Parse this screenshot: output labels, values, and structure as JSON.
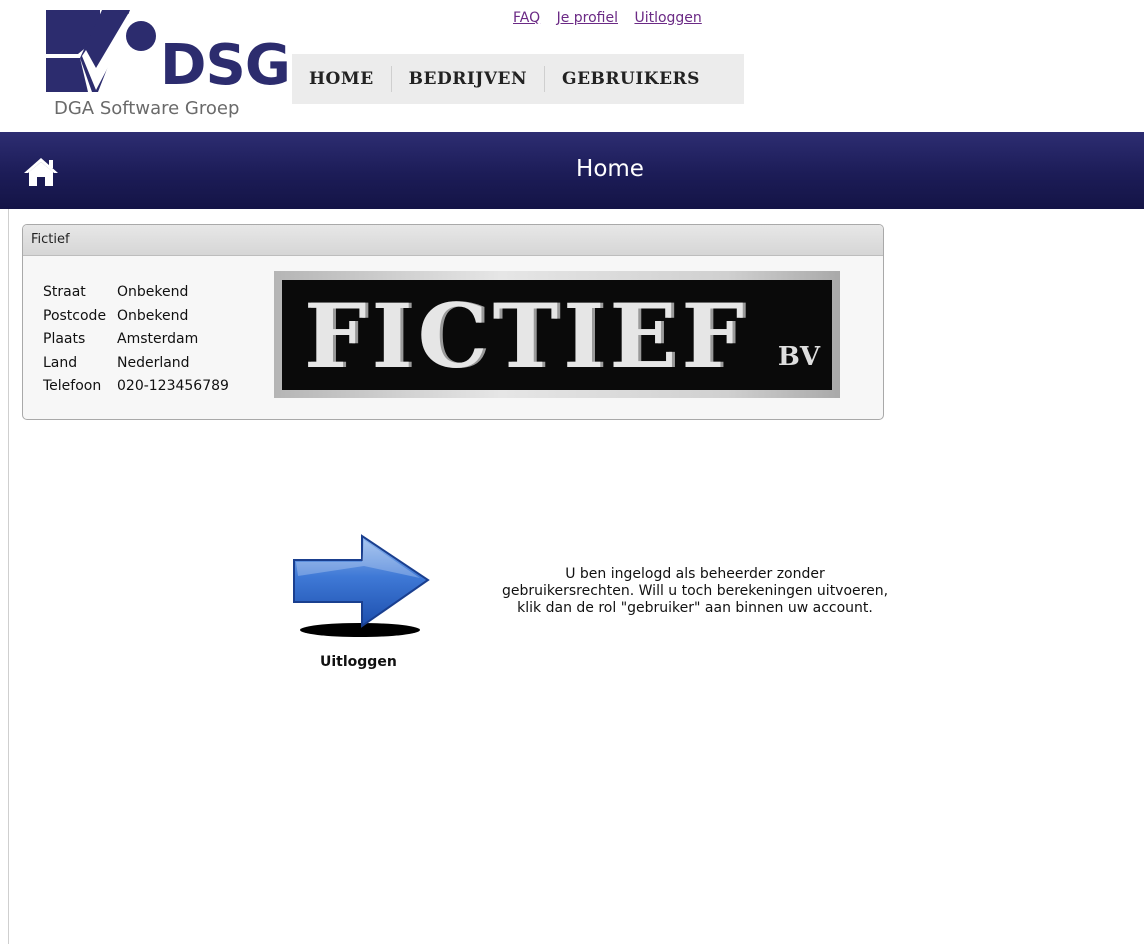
{
  "brand": {
    "name": "DSG",
    "tagline": "DGA Software Groep",
    "accent_color": "#2c2c6e"
  },
  "top_links": [
    {
      "label": "FAQ"
    },
    {
      "label": "Je profiel"
    },
    {
      "label": "Uitloggen"
    }
  ],
  "main_nav": [
    {
      "label": "HOME"
    },
    {
      "label": "BEDRIJVEN"
    },
    {
      "label": "GEBRUIKERS"
    }
  ],
  "header": {
    "title": "Home",
    "icon": "home-icon",
    "background_color": "#1c1c57"
  },
  "company": {
    "panel_title": "Fictief",
    "fields": [
      {
        "label": "Straat",
        "value": "Onbekend"
      },
      {
        "label": "Postcode",
        "value": "Onbekend"
      },
      {
        "label": "Plaats",
        "value": "Amsterdam"
      },
      {
        "label": "Land",
        "value": "Nederland"
      },
      {
        "label": "Telefoon",
        "value": "020-123456789"
      }
    ],
    "logo_text": "FICTIEF",
    "logo_suffix": "BV"
  },
  "action": {
    "label": "Uitloggen",
    "icon": "arrow-right-icon"
  },
  "message": "U ben ingelogd als beheerder zonder gebruikersrechten. Will u toch berekeningen uitvoeren, klik dan de rol \"gebruiker\" aan binnen uw account."
}
